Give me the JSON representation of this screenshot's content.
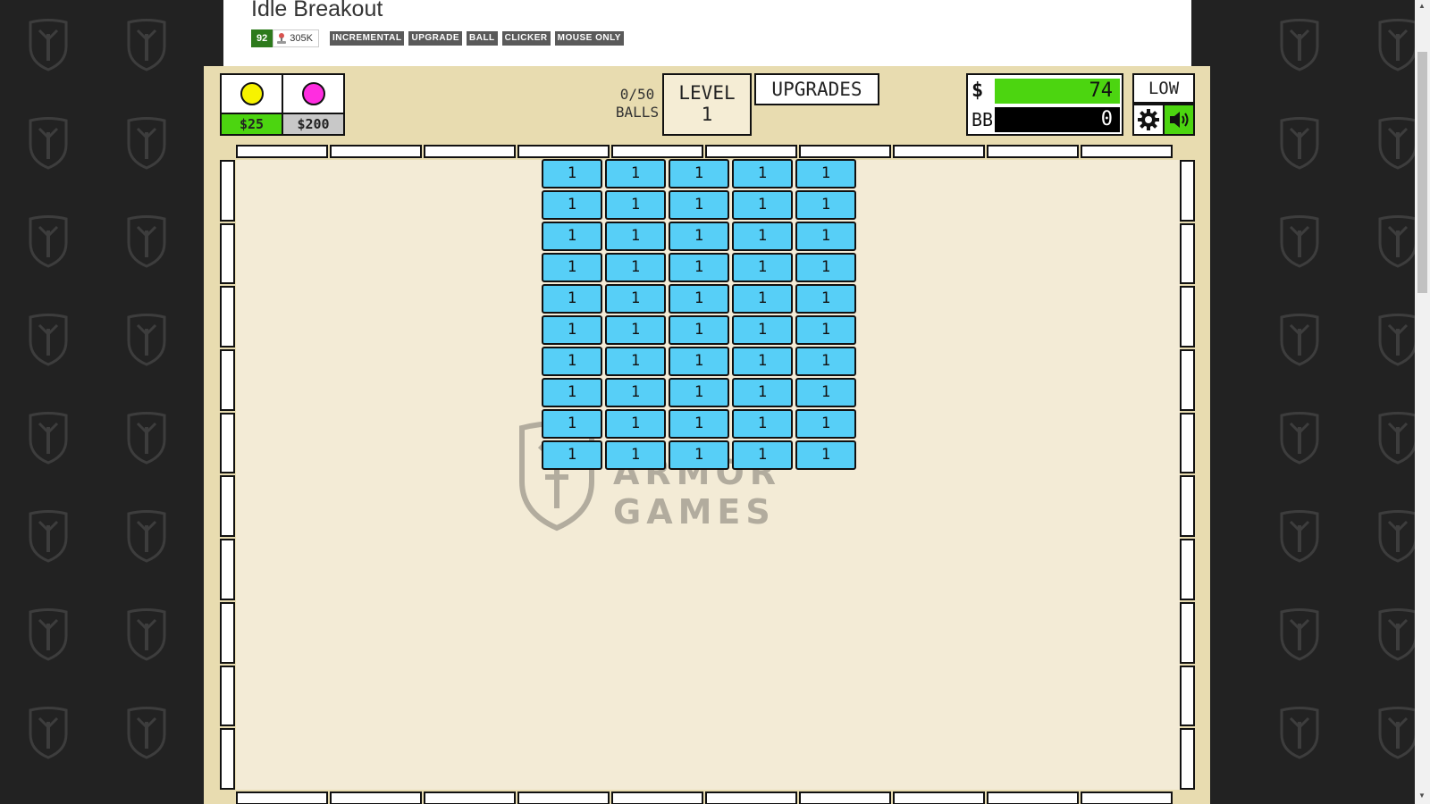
{
  "page": {
    "title": "Idle Breakout",
    "rating": "92",
    "plays": "305K",
    "tags": [
      "INCREMENTAL",
      "UPGRADE",
      "BALL",
      "CLICKER",
      "MOUSE ONLY"
    ],
    "watermark": "ARMOR GAMES"
  },
  "game": {
    "ball_shop": [
      {
        "name": "basic-ball",
        "price": "$25",
        "color": "#f7f300",
        "price_bg": "#4cd510"
      },
      {
        "name": "plasma-ball",
        "price": "$200",
        "color": "#ff2de0",
        "price_bg": "#c8c8c8"
      }
    ],
    "balls_count": "0/50",
    "balls_label": "BALLS",
    "level_label": "LEVEL",
    "level_value": "1",
    "upgrades_label": "UPGRADES",
    "money_label": "$",
    "money_value": "74",
    "bb_label": "BB",
    "bb_value": "0",
    "quality_label": "LOW",
    "bricks": {
      "rows": 10,
      "cols": 5,
      "value": "1",
      "color": "#57cff7"
    }
  },
  "colors": {
    "frame": "#e8dcb0",
    "play_area": "#f3ebd6",
    "accent_green": "#4cd510",
    "rating_green": "#2d7a1c"
  }
}
